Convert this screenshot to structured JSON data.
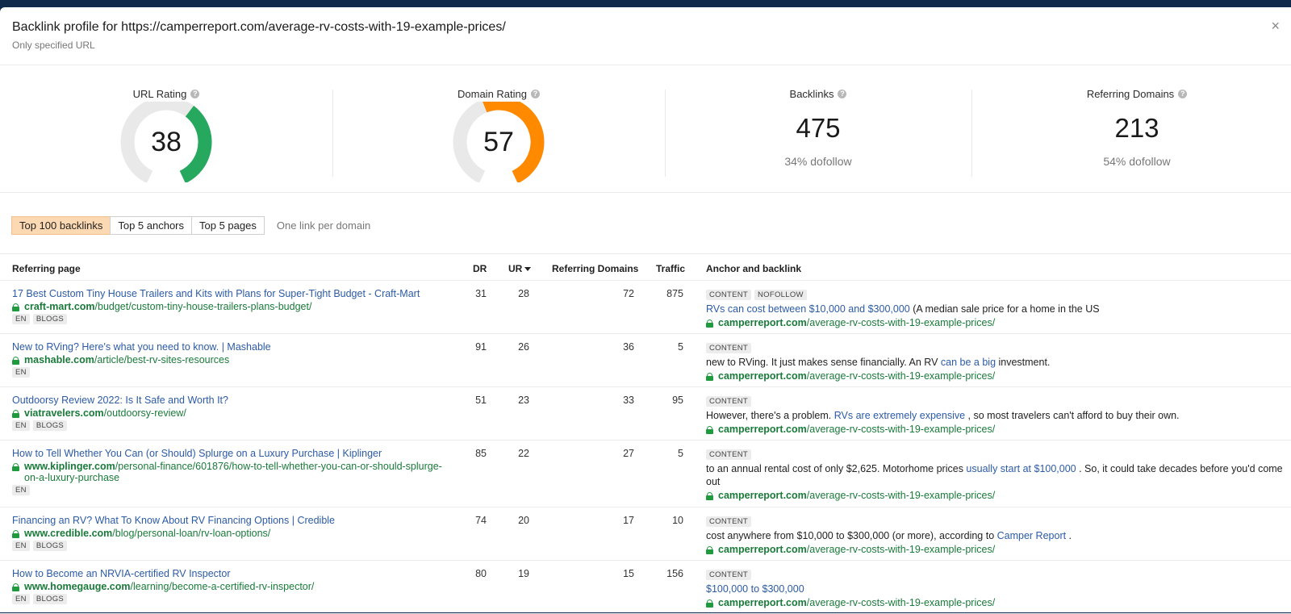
{
  "header": {
    "title": "Backlink profile for https://camperreport.com/average-rv-costs-with-19-example-prices/",
    "subtitle": "Only specified URL",
    "close": "×"
  },
  "metrics": {
    "url_rating": {
      "label": "URL Rating",
      "value": "38",
      "fraction": 0.38,
      "color": "#27a85f"
    },
    "domain_rating": {
      "label": "Domain Rating",
      "value": "57",
      "fraction": 0.57,
      "color": "#ff8a00"
    },
    "backlinks": {
      "label": "Backlinks",
      "value": "475",
      "sub": "34% dofollow"
    },
    "referring_domains": {
      "label": "Referring Domains",
      "value": "213",
      "sub": "54% dofollow"
    },
    "help_glyph": "?"
  },
  "tabs": {
    "items": [
      "Top 100 backlinks",
      "Top 5 anchors",
      "Top 5 pages"
    ],
    "active": 0,
    "option": "One link per domain"
  },
  "table": {
    "columns": {
      "referring_page": "Referring page",
      "dr": "DR",
      "ur": "UR",
      "referring_domains": "Referring Domains",
      "traffic": "Traffic",
      "anchor": "Anchor and backlink"
    },
    "target_domain": "camperreport.com",
    "target_path": "/average-rv-costs-with-19-example-prices/",
    "rows": [
      {
        "title": "17 Best Custom Tiny House Trailers and Kits with Plans for Super-Tight Budget - Craft-Mart",
        "domain": "craft-mart.com",
        "path": "/budget/custom-tiny-house-trailers-plans-budget/",
        "tags": [
          "EN",
          "BLOGS"
        ],
        "dr": "31",
        "ur": "28",
        "rd": "72",
        "traffic": "875",
        "anchor_tags": [
          "CONTENT",
          "NOFOLLOW"
        ],
        "anchor_before": "",
        "anchor_link": "RVs can cost between $10,000 and $300,000",
        "anchor_after": " (A median sale price for a home in the US"
      },
      {
        "title": "New to RVing? Here's what you need to know. | Mashable",
        "domain": "mashable.com",
        "path": "/article/best-rv-sites-resources",
        "tags": [
          "EN"
        ],
        "dr": "91",
        "ur": "26",
        "rd": "36",
        "traffic": "5",
        "anchor_tags": [
          "CONTENT"
        ],
        "anchor_before": "new to RVing. It just makes sense financially. An RV ",
        "anchor_link": "can be a big",
        "anchor_after": " investment."
      },
      {
        "title": "Outdoorsy Review 2022: Is It Safe and Worth It?",
        "domain": "viatravelers.com",
        "path": "/outdoorsy-review/",
        "tags": [
          "EN",
          "BLOGS"
        ],
        "dr": "51",
        "ur": "23",
        "rd": "33",
        "traffic": "95",
        "anchor_tags": [
          "CONTENT"
        ],
        "anchor_before": "However, there's a problem. ",
        "anchor_link": "RVs are extremely expensive",
        "anchor_after": " , so most travelers can't afford to buy their own."
      },
      {
        "title": "How to Tell Whether You Can (or Should) Splurge on a Luxury Purchase | Kiplinger",
        "domain": "www.kiplinger.com",
        "path": "/personal-finance/601876/how-to-tell-whether-you-can-or-should-splurge-on-a-luxury-purchase",
        "tags": [
          "EN"
        ],
        "dr": "85",
        "ur": "22",
        "rd": "27",
        "traffic": "5",
        "anchor_tags": [
          "CONTENT"
        ],
        "anchor_before": "to an annual rental cost of only $2,625. Motorhome prices ",
        "anchor_link": "usually start at $100,000",
        "anchor_after": " . So, it could take decades before you'd come out"
      },
      {
        "title": "Financing an RV? What To Know About RV Financing Options | Credible",
        "domain": "www.credible.com",
        "path": "/blog/personal-loan/rv-loan-options/",
        "tags": [
          "EN",
          "BLOGS"
        ],
        "dr": "74",
        "ur": "20",
        "rd": "17",
        "traffic": "10",
        "anchor_tags": [
          "CONTENT"
        ],
        "anchor_before": "cost anywhere from $10,000 to $300,000 (or more), according to ",
        "anchor_link": "Camper Report",
        "anchor_after": " ."
      },
      {
        "title": "How to Become an NRVIA-certified RV Inspector",
        "domain": "www.homegauge.com",
        "path": "/learning/become-a-certified-rv-inspector/",
        "tags": [
          "EN",
          "BLOGS"
        ],
        "dr": "80",
        "ur": "19",
        "rd": "15",
        "traffic": "156",
        "anchor_tags": [
          "CONTENT"
        ],
        "anchor_before": "",
        "anchor_link": "$100,000 to $300,000",
        "anchor_after": ""
      }
    ]
  }
}
